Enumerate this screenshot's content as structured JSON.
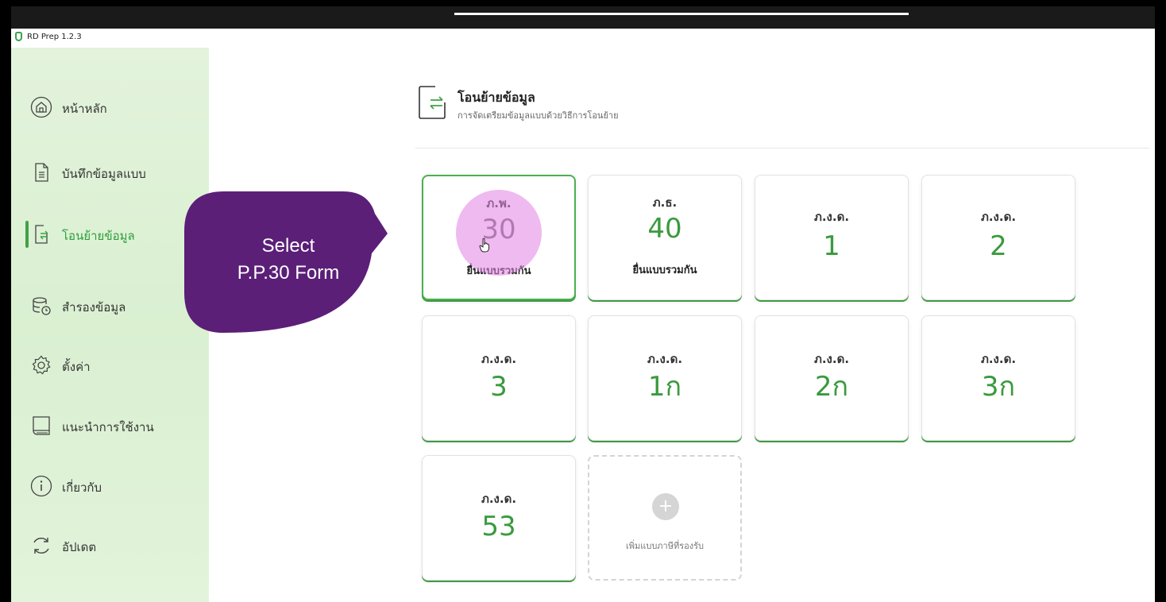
{
  "window": {
    "title": "RD Prep 1.2.3"
  },
  "sidebar": {
    "items": [
      {
        "label": "หน้าหลัก",
        "icon": "home-icon",
        "active": false
      },
      {
        "label": "บันทึกข้อมูลแบบ",
        "icon": "document-icon",
        "active": false
      },
      {
        "label": "โอนย้ายข้อมูล",
        "icon": "transfer-icon",
        "active": true
      },
      {
        "label": "สำรองข้อมูล",
        "icon": "database-backup-icon",
        "active": false
      },
      {
        "label": "ตั้งค่า",
        "icon": "gear-icon",
        "active": false
      },
      {
        "label": "แนะนำการใช้งาน",
        "icon": "book-icon",
        "active": false
      },
      {
        "label": "เกี่ยวกับ",
        "icon": "info-icon",
        "active": false
      },
      {
        "label": "อัปเดต",
        "icon": "refresh-icon",
        "active": false
      }
    ]
  },
  "page": {
    "title": "โอนย้ายข้อมูล",
    "subtitle": "การจัดเตรียมข้อมูลแบบด้วยวิธีการโอนย้าย"
  },
  "forms": [
    {
      "top": "ภ.พ.",
      "number": "30",
      "bottom": "ยื่นแบบรวมกัน",
      "selected": true
    },
    {
      "top": "ภ.ธ.",
      "number": "40",
      "bottom": "ยื่นแบบรวมกัน",
      "selected": false
    },
    {
      "top": "ภ.ง.ด.",
      "number": "1",
      "bottom": "",
      "selected": false
    },
    {
      "top": "ภ.ง.ด.",
      "number": "2",
      "bottom": "",
      "selected": false
    },
    {
      "top": "ภ.ง.ด.",
      "number": "3",
      "bottom": "",
      "selected": false
    },
    {
      "top": "ภ.ง.ด.",
      "number": "1ก",
      "bottom": "",
      "selected": false
    },
    {
      "top": "ภ.ง.ด.",
      "number": "2ก",
      "bottom": "",
      "selected": false
    },
    {
      "top": "ภ.ง.ด.",
      "number": "3ก",
      "bottom": "",
      "selected": false
    },
    {
      "top": "ภ.ง.ด.",
      "number": "53",
      "bottom": "",
      "selected": false
    }
  ],
  "add_form": {
    "label": "เพิ่มแบบภาษีที่รองรับ",
    "icon": "plus-icon"
  },
  "callout": {
    "line1": "Select",
    "line2": "P.P.30 Form"
  },
  "colors": {
    "accent": "#43a047",
    "sidebar_bg": "#e0f2d8",
    "callout": "#5b1f78",
    "highlight": "#e082e0"
  }
}
